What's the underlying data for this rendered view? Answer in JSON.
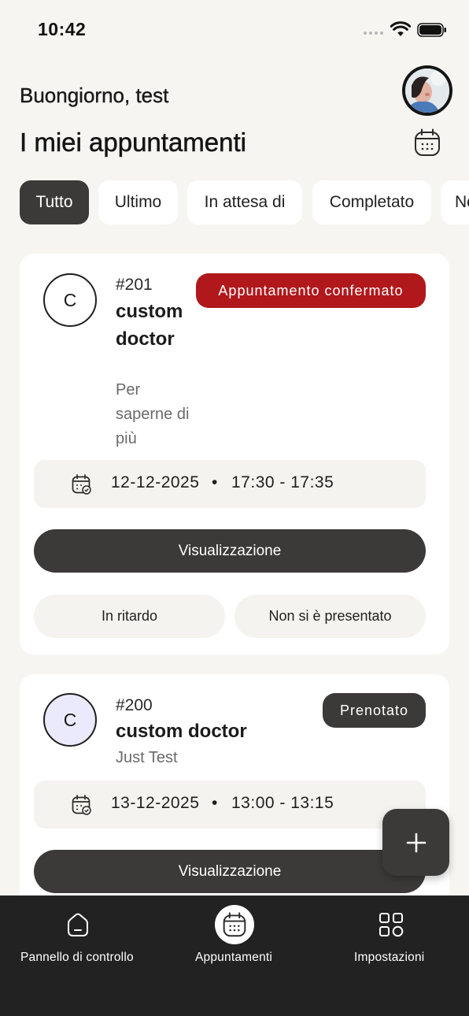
{
  "status_bar": {
    "time": "10:42"
  },
  "header": {
    "greeting": "Buongiorno, test",
    "title": "I miei appuntamenti"
  },
  "tabs": [
    {
      "label": "Tutto",
      "active": true
    },
    {
      "label": "Ultimo",
      "active": false
    },
    {
      "label": "In attesa di",
      "active": false
    },
    {
      "label": "Completato",
      "active": false
    },
    {
      "label": "No",
      "active": false
    }
  ],
  "appointments": [
    {
      "initial": "C",
      "number": "#201",
      "doctor": "custom doctor",
      "note": "Per saperne di più",
      "status": "Appuntamento confermato",
      "status_color": "#b0181c",
      "avatar_color": "#dff6fa",
      "date": "12-12-2025",
      "separator": "•",
      "time": "17:30 - 17:35",
      "view_label": "Visualizzazione",
      "late_label": "In ritardo",
      "noshow_label": "Non si è presentato"
    },
    {
      "initial": "C",
      "number": "#200",
      "doctor": "custom doctor",
      "note": "Just Test",
      "status": "Prenotato",
      "status_color": "#3b3a38",
      "avatar_color": "#ebe9fc",
      "date": "13-12-2025",
      "separator": "•",
      "time": "13:00 - 13:15",
      "view_label": "Visualizzazione"
    }
  ],
  "fab": {
    "icon": "plus-icon"
  },
  "bottom_nav": [
    {
      "label": "Pannello di controllo",
      "icon": "home-icon",
      "active": false
    },
    {
      "label": "Appuntamenti",
      "icon": "calendar-icon",
      "active": true
    },
    {
      "label": "Impostazioni",
      "icon": "grid-icon",
      "active": false
    }
  ]
}
